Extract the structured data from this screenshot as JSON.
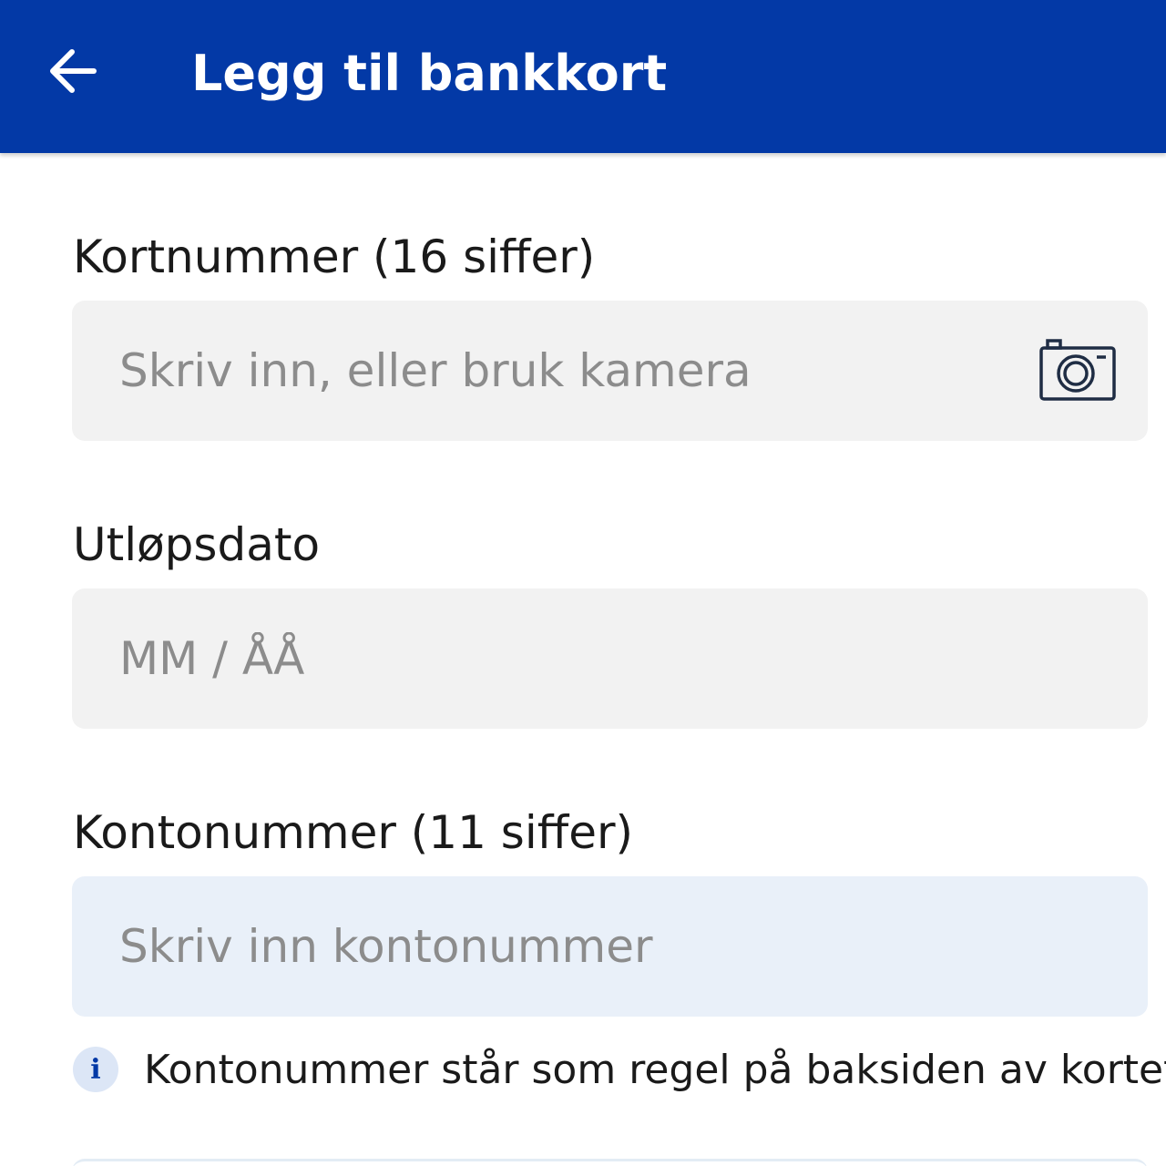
{
  "header": {
    "title": "Legg til bankkort",
    "back_icon": "arrow-left-icon",
    "background": "#0339A6"
  },
  "card_number": {
    "label": "Kortnummer (16 siffer)",
    "placeholder": "Skriv inn, eller bruk kamera",
    "value": "",
    "camera_icon": "camera-icon"
  },
  "expiry": {
    "label": "Utløpsdato",
    "placeholder": "MM / ÅÅ",
    "value": ""
  },
  "account_number": {
    "label": "Kontonummer (11 siffer)",
    "placeholder": "Skriv inn kontonummer",
    "value": ""
  },
  "info": {
    "icon_glyph": "i",
    "icon": "info-icon",
    "text": "Kontonummer står som regel på baksiden av kortet"
  }
}
